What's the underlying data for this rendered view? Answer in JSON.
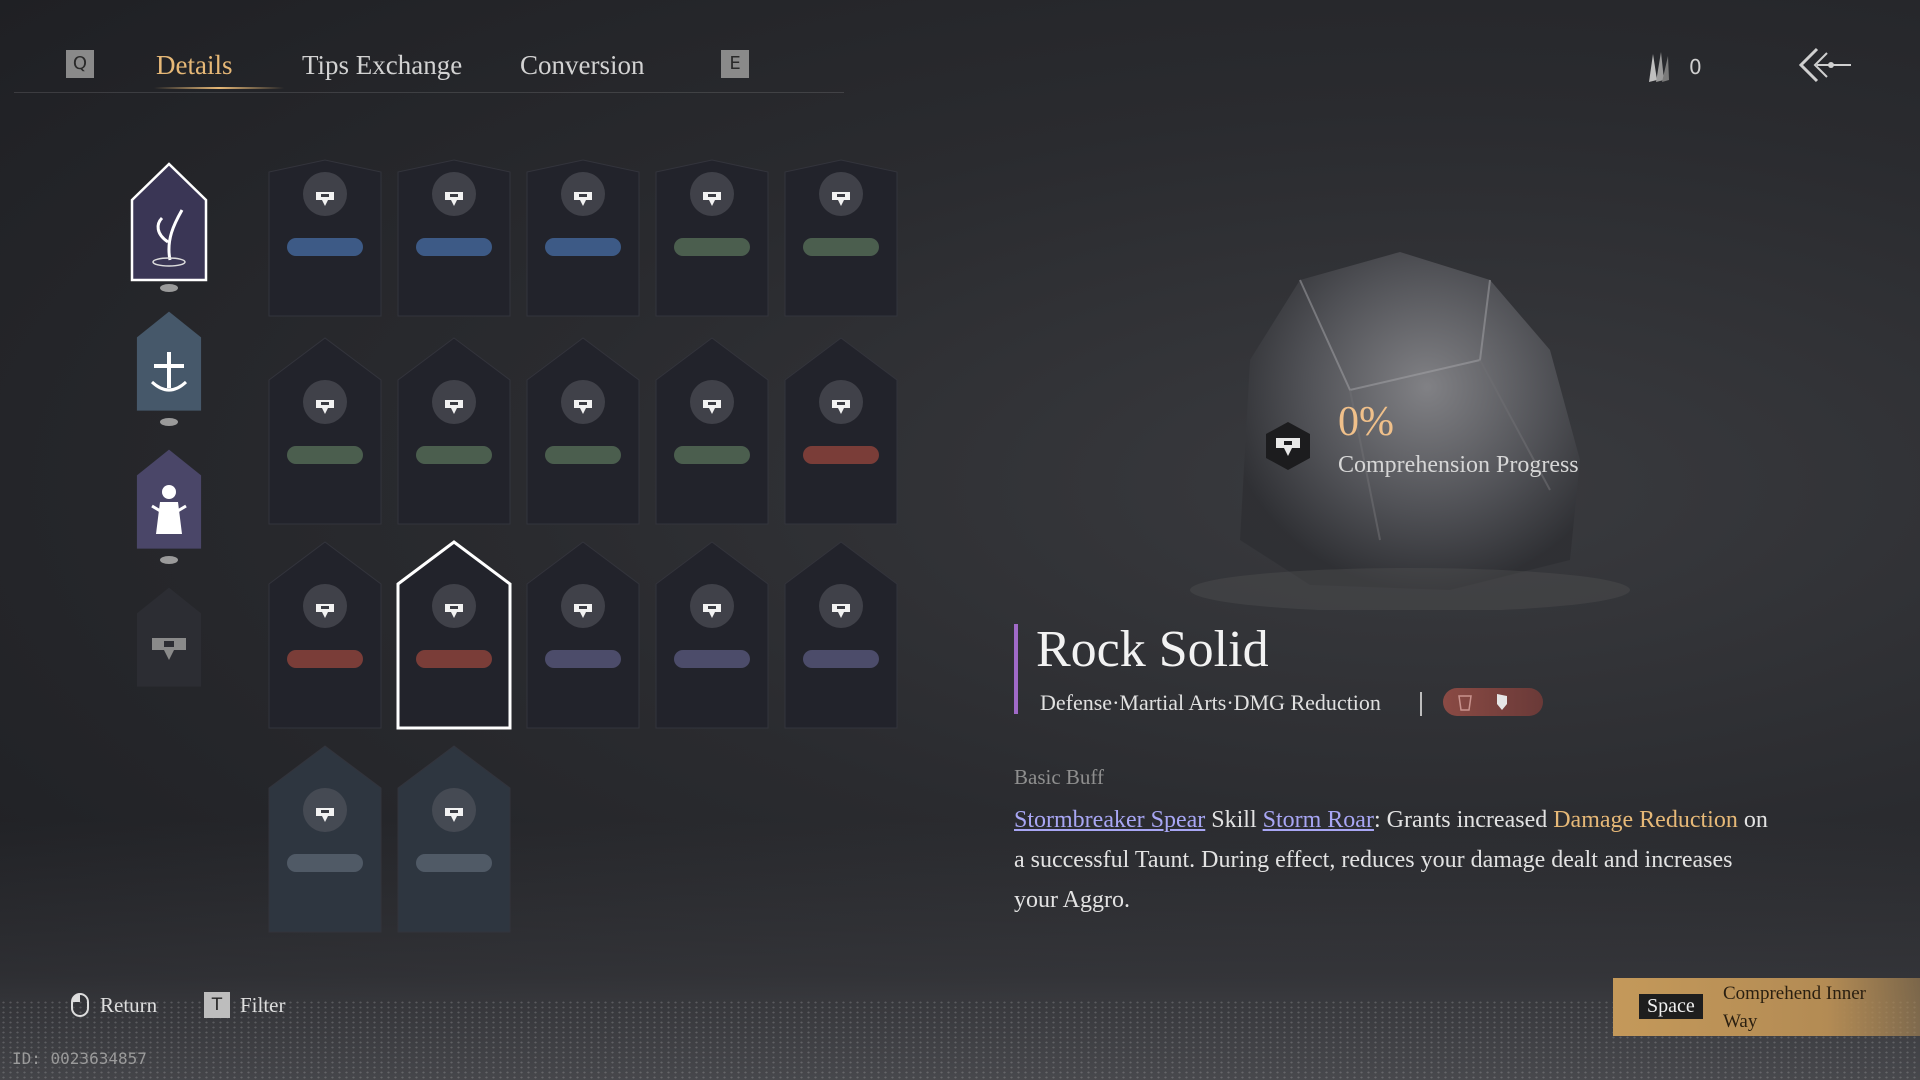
{
  "header": {
    "prev_key": "Q",
    "next_key": "E",
    "tabs": [
      {
        "label": "Details",
        "active": true
      },
      {
        "label": "Tips Exchange",
        "active": false
      },
      {
        "label": "Conversion",
        "active": false
      }
    ],
    "currency_value": "0",
    "currency_icon": "quill-icon",
    "back_icon": "back-arrow-icon"
  },
  "categories": [
    {
      "icon": "water-plant-icon",
      "selected": true
    },
    {
      "icon": "sword-anchor-icon",
      "selected": false
    },
    {
      "icon": "figure-icon",
      "selected": false
    },
    {
      "icon": "badge-icon",
      "selected": false
    }
  ],
  "grid": [
    {
      "icon": "wolf-icon",
      "tag": "blue",
      "selected": false
    },
    {
      "icon": "warrior-icon",
      "tag": "blue",
      "selected": false
    },
    {
      "icon": "bow-icon",
      "tag": "blue",
      "selected": false
    },
    {
      "icon": "fruit-icon",
      "tag": "green",
      "selected": false
    },
    {
      "icon": "tree-icon",
      "tag": "green",
      "selected": false
    },
    {
      "icon": "ring-icon",
      "tag": "green",
      "selected": false
    },
    {
      "icon": "flower-icon",
      "tag": "green",
      "selected": false
    },
    {
      "icon": "yin-yang-icon",
      "tag": "green",
      "selected": false
    },
    {
      "icon": "leaf-icon",
      "tag": "green",
      "selected": false
    },
    {
      "icon": "crab-icon",
      "tag": "red",
      "selected": false
    },
    {
      "icon": "bell-icon",
      "tag": "red",
      "selected": false
    },
    {
      "icon": "rock-icon",
      "tag": "red",
      "selected": true
    },
    {
      "icon": "shadow-icon",
      "tag": "purple",
      "selected": false
    },
    {
      "icon": "swordsman-icon",
      "tag": "purple",
      "selected": false
    },
    {
      "icon": "dragon-icon",
      "tag": "purple",
      "selected": false
    },
    {
      "icon": "swirl-icon",
      "tag": "white",
      "selected": false
    },
    {
      "icon": "wing-icon",
      "tag": "white",
      "selected": false
    }
  ],
  "detail": {
    "progress_value": "0%",
    "progress_label": "Comprehension Progress",
    "title": "Rock Solid",
    "subtitle": "Defense·Martial Arts·DMG Reduction",
    "section_label": "Basic Buff",
    "desc_link1": "Stormbreaker Spear",
    "desc_t1": " Skill ",
    "desc_link2": "Storm Roar",
    "desc_t2": ": Grants increased ",
    "desc_hl": "Damage Reduction",
    "desc_t3": " on a successful Taunt. During effect, reduces your damage dealt and increases your Aggro."
  },
  "footer": {
    "return_label": "Return",
    "filter_key": "T",
    "filter_label": "Filter",
    "space_key": "Space",
    "comprehend_label": "Comprehend Inner Way",
    "uid": "ID: 0023634857"
  },
  "colors": {
    "accent_gold": "#e6b877",
    "link_purple": "#a8a6f4",
    "title_bar": "#a06ac8",
    "tag_blue": "#3d5a86",
    "tag_green": "#4b5e4e",
    "tag_red": "#7a3d38",
    "tag_purple": "#4c4c6a"
  }
}
